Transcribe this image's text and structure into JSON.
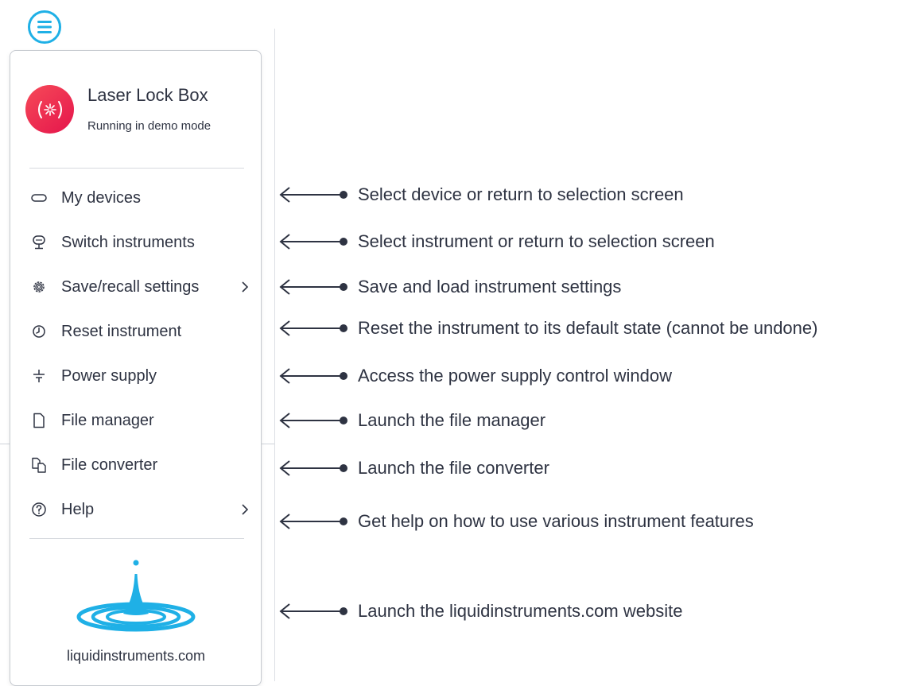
{
  "menu_header": {
    "app_name": "Laser Lock Box",
    "status": "Running in demo mode"
  },
  "menu_items": [
    {
      "label": "My devices",
      "icon": "device-icon"
    },
    {
      "label": "Switch instruments",
      "icon": "instrument-icon"
    },
    {
      "label": "Save/recall settings",
      "icon": "gear-icon",
      "submenu": true
    },
    {
      "label": "Reset instrument",
      "icon": "reset-icon"
    },
    {
      "label": "Power supply",
      "icon": "power-supply-icon"
    },
    {
      "label": "File manager",
      "icon": "file-icon"
    },
    {
      "label": "File converter",
      "icon": "file-converter-icon"
    },
    {
      "label": "Help",
      "icon": "help-icon",
      "submenu": true
    }
  ],
  "footer": {
    "website": "liquidinstruments.com"
  },
  "annotations": [
    "Select device or return to selection screen",
    "Select instrument or return to selection screen",
    "Save and load instrument settings",
    "Reset the instrument to its default state (cannot be undone)",
    "Access the power supply control window",
    "Launch the file manager",
    "Launch the file converter",
    "Get help on how to use various instrument features",
    "Launch the liquidinstruments.com website"
  ],
  "colors": {
    "accent": "#1fb0e6",
    "brand_red": "#e91c4e",
    "text": "#2e3342"
  }
}
